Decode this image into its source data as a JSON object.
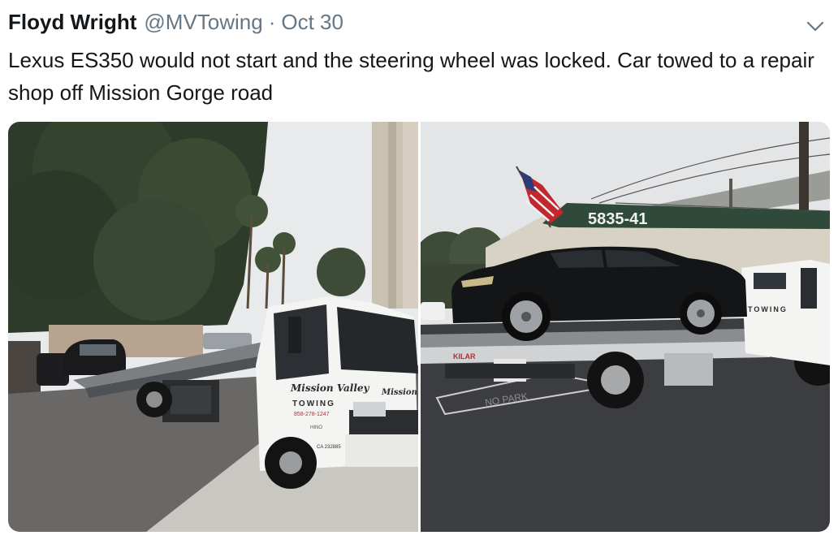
{
  "tweet": {
    "author_name": "Floyd Wright",
    "handle": "@MVTowing",
    "separator": "·",
    "date": "Oct 30",
    "text": "Lexus ES350 would not start and the steering wheel was locked. Car towed to a repair shop off Mission Gorge road",
    "menu_icon": "chevron-down-icon"
  },
  "media": {
    "photos": [
      {
        "subject": "white flatbed tow truck in parking lot",
        "truck_door_text": "Mission Valley",
        "truck_door_sub": "TOWING",
        "truck_phone": "858-278-1247",
        "truck_brand": "HINO",
        "truck_plate": "CA 232885",
        "hood_text": "Mission V"
      },
      {
        "subject": "black Lexus ES350 loaded on flatbed tow truck",
        "building_number": "5835-41",
        "bed_brand": "KILAR",
        "cab_text": "TOWING",
        "ground_text": "NO PARK"
      }
    ]
  },
  "colors": {
    "text_primary": "#14171a",
    "text_secondary": "#657786",
    "background": "#ffffff",
    "truck_white": "#f4f4f2",
    "sky": "#e9eaec"
  }
}
